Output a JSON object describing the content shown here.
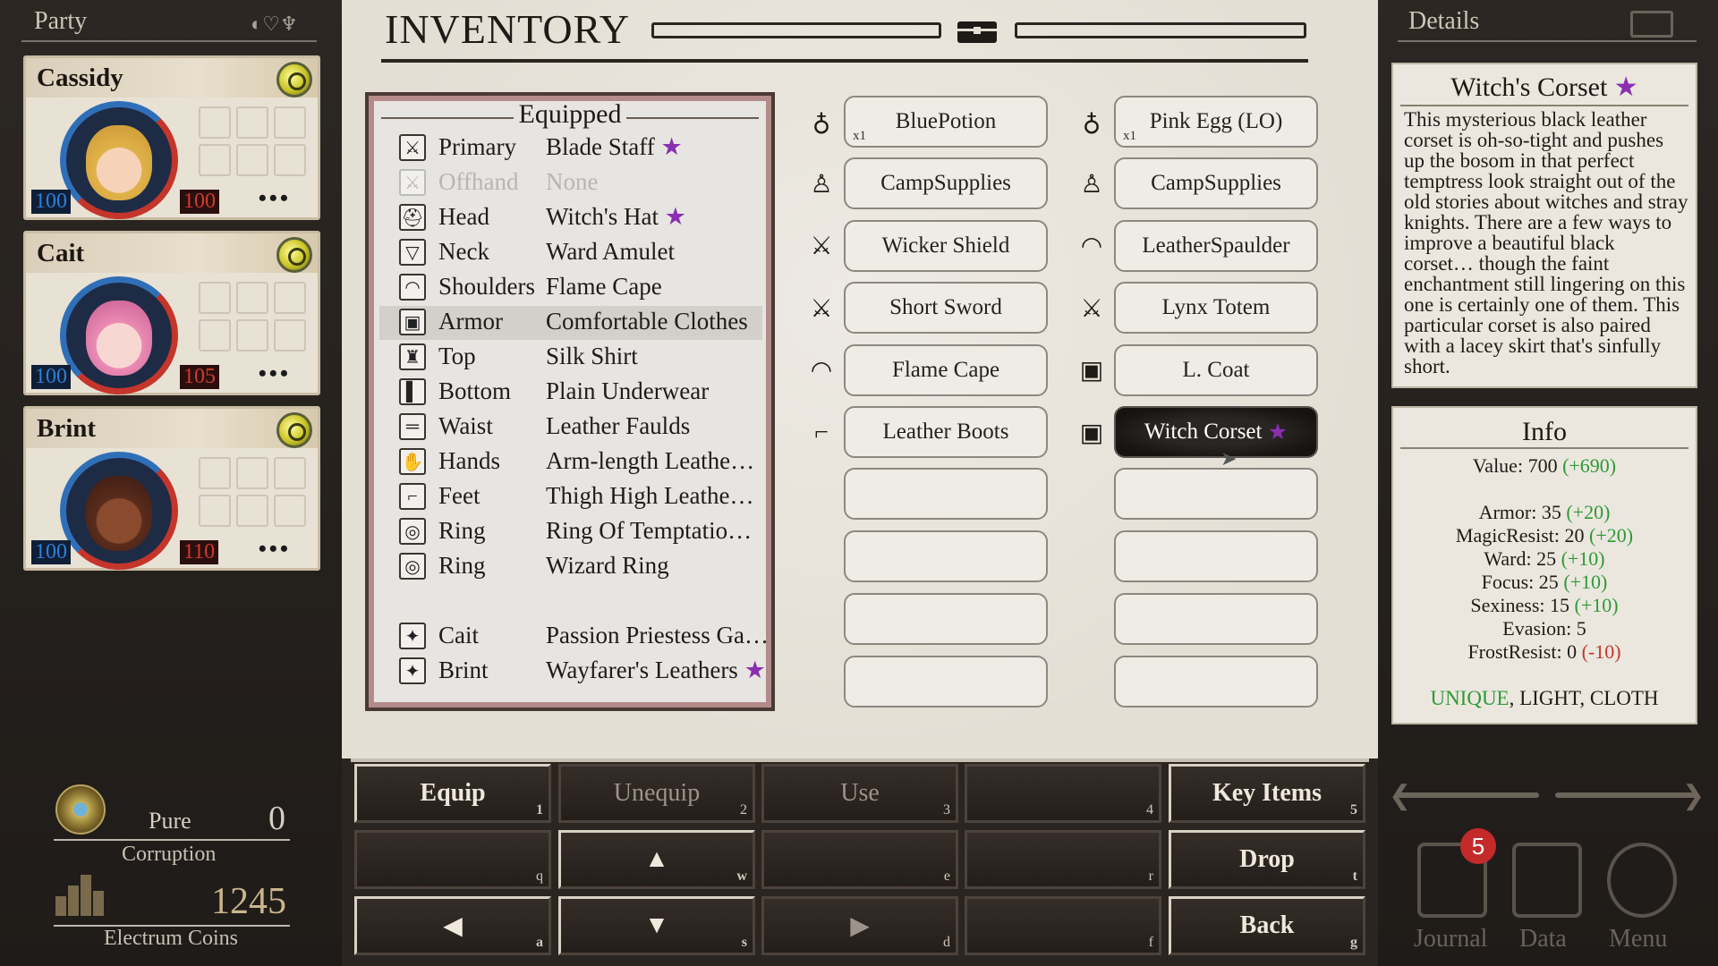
{
  "party": {
    "title": "Party",
    "members": [
      {
        "name": "Cassidy",
        "hp": "100",
        "mp": "100",
        "more": "•••"
      },
      {
        "name": "Cait",
        "hp": "100",
        "mp": "105",
        "more": "•••"
      },
      {
        "name": "Brint",
        "hp": "100",
        "mp": "110",
        "more": "•••"
      }
    ],
    "corruption": {
      "state": "Pure",
      "value": "0",
      "label": "Corruption"
    },
    "currency": {
      "value": "1245",
      "label": "Electrum Coins"
    }
  },
  "inventory": {
    "title": "INVENTORY",
    "equipped_title": "Equipped",
    "equipped": [
      {
        "slot": "Primary",
        "item": "Blade Staff",
        "star": "★",
        "icon": "sword-icon"
      },
      {
        "slot": "Offhand",
        "item": "None",
        "star": "",
        "icon": "sword-icon"
      },
      {
        "slot": "Head",
        "item": "Witch's Hat",
        "star": "★",
        "icon": "helmet-icon"
      },
      {
        "slot": "Neck",
        "item": "Ward Amulet",
        "star": "",
        "icon": "amulet-icon"
      },
      {
        "slot": "Shoulders",
        "item": "Flame Cape",
        "star": "",
        "icon": "shoulder-icon"
      },
      {
        "slot": "Armor",
        "item": "Comfortable Clothes",
        "star": "",
        "icon": "armor-icon"
      },
      {
        "slot": "Top",
        "item": "Silk Shirt",
        "star": "",
        "icon": "shirt-icon"
      },
      {
        "slot": "Bottom",
        "item": "Plain Underwear",
        "star": "",
        "icon": "pants-icon"
      },
      {
        "slot": "Waist",
        "item": "Leather Faulds",
        "star": "",
        "icon": "belt-icon"
      },
      {
        "slot": "Hands",
        "item": "Arm-length Leathe…",
        "star": "",
        "icon": "glove-icon"
      },
      {
        "slot": "Feet",
        "item": "Thigh High Leathe…",
        "star": "",
        "icon": "boot-icon"
      },
      {
        "slot": "Ring",
        "item": "Ring Of Temptatio…",
        "star": "",
        "icon": "ring-icon"
      },
      {
        "slot": "Ring",
        "item": "Wizard Ring",
        "star": "",
        "icon": "ring-icon"
      },
      {
        "slot": "Cait",
        "item": "Passion Priestess Ga…",
        "star": "",
        "icon": "companion-icon"
      },
      {
        "slot": "Brint",
        "item": "Wayfarer's Leathers",
        "star": "★",
        "icon": "companion-icon"
      }
    ],
    "items_left": [
      {
        "name": "BluePotion",
        "qty": "x1",
        "icon": "potion-icon"
      },
      {
        "name": "CampSupplies",
        "qty": "",
        "icon": "bag-icon"
      },
      {
        "name": "Wicker Shield",
        "qty": "",
        "icon": "sword-icon"
      },
      {
        "name": "Short Sword",
        "qty": "",
        "icon": "sword-icon"
      },
      {
        "name": "Flame Cape",
        "qty": "",
        "icon": "shoulder-icon"
      },
      {
        "name": "Leather Boots",
        "qty": "",
        "icon": "boot-icon"
      },
      {
        "name": "",
        "qty": "",
        "icon": ""
      },
      {
        "name": "",
        "qty": "",
        "icon": ""
      },
      {
        "name": "",
        "qty": "",
        "icon": ""
      },
      {
        "name": "",
        "qty": "",
        "icon": ""
      }
    ],
    "items_right": [
      {
        "name": "Pink Egg (LO)",
        "qty": "x1",
        "icon": "potion-icon"
      },
      {
        "name": "CampSupplies",
        "qty": "",
        "icon": "bag-icon"
      },
      {
        "name": "LeatherSpaulder",
        "qty": "",
        "icon": "shoulder-icon"
      },
      {
        "name": "Lynx Totem",
        "qty": "",
        "icon": "sword-icon"
      },
      {
        "name": "L. Coat",
        "qty": "",
        "icon": "armor-icon"
      },
      {
        "name": "Witch Corset",
        "qty": "",
        "icon": "armor-icon",
        "star": "★",
        "selected": true
      },
      {
        "name": "",
        "qty": "",
        "icon": ""
      },
      {
        "name": "",
        "qty": "",
        "icon": ""
      },
      {
        "name": "",
        "qty": "",
        "icon": ""
      },
      {
        "name": "",
        "qty": "",
        "icon": ""
      }
    ]
  },
  "actions": [
    {
      "label": "Equip",
      "key": "1"
    },
    {
      "label": "Unequip",
      "key": "2"
    },
    {
      "label": "Use",
      "key": "3"
    },
    {
      "label": "",
      "key": "4"
    },
    {
      "label": "Key Items",
      "key": "5"
    },
    {
      "label": "",
      "key": "q"
    },
    {
      "label": "▲",
      "key": "w"
    },
    {
      "label": "",
      "key": "e"
    },
    {
      "label": "",
      "key": "r"
    },
    {
      "label": "Drop",
      "key": "t"
    },
    {
      "label": "◀",
      "key": "a"
    },
    {
      "label": "▼",
      "key": "s"
    },
    {
      "label": "▶",
      "key": "d"
    },
    {
      "label": "",
      "key": "f"
    },
    {
      "label": "Back",
      "key": "g"
    }
  ],
  "details": {
    "title": "Details",
    "item_name": "Witch's Corset",
    "item_star": "★",
    "description": "This mysterious black leather corset is oh-so-tight and pushes up the bosom in that perfect temptress look straight out of the old stories about witches and stray knights. There are a few ways to improve a beautiful black corset… though the faint enchantment still lingering on this one is certainly one of them. This particular corset is also paired with a lacey skirt that's sinfully short.",
    "info_title": "Info",
    "value": {
      "label": "Value: 700",
      "delta": "(+690)"
    },
    "stats": [
      {
        "label": "Armor: 35",
        "delta": "(+20)",
        "tone": "g"
      },
      {
        "label": "MagicResist: 20",
        "delta": "(+20)",
        "tone": "g"
      },
      {
        "label": "Ward: 25",
        "delta": "(+10)",
        "tone": "g"
      },
      {
        "label": "Focus: 25",
        "delta": "(+10)",
        "tone": "g"
      },
      {
        "label": "Sexiness: 15",
        "delta": "(+10)",
        "tone": "g"
      },
      {
        "label": "Evasion: 5",
        "delta": "",
        "tone": "g"
      },
      {
        "label": "FrostResist: 0",
        "delta": "(-10)",
        "tone": "r"
      }
    ],
    "tags": {
      "unique": "UNIQUE",
      "rest": ", LIGHT, CLOTH"
    }
  },
  "nav": {
    "journal": "Journal",
    "journal_badge": "5",
    "data": "Data",
    "menu": "Menu"
  },
  "colors": {
    "positive": "#2d9a35",
    "negative": "#c2372b",
    "star": "#8a2fb0",
    "hp": "#2f7fd6",
    "mp": "#d23a2c"
  }
}
